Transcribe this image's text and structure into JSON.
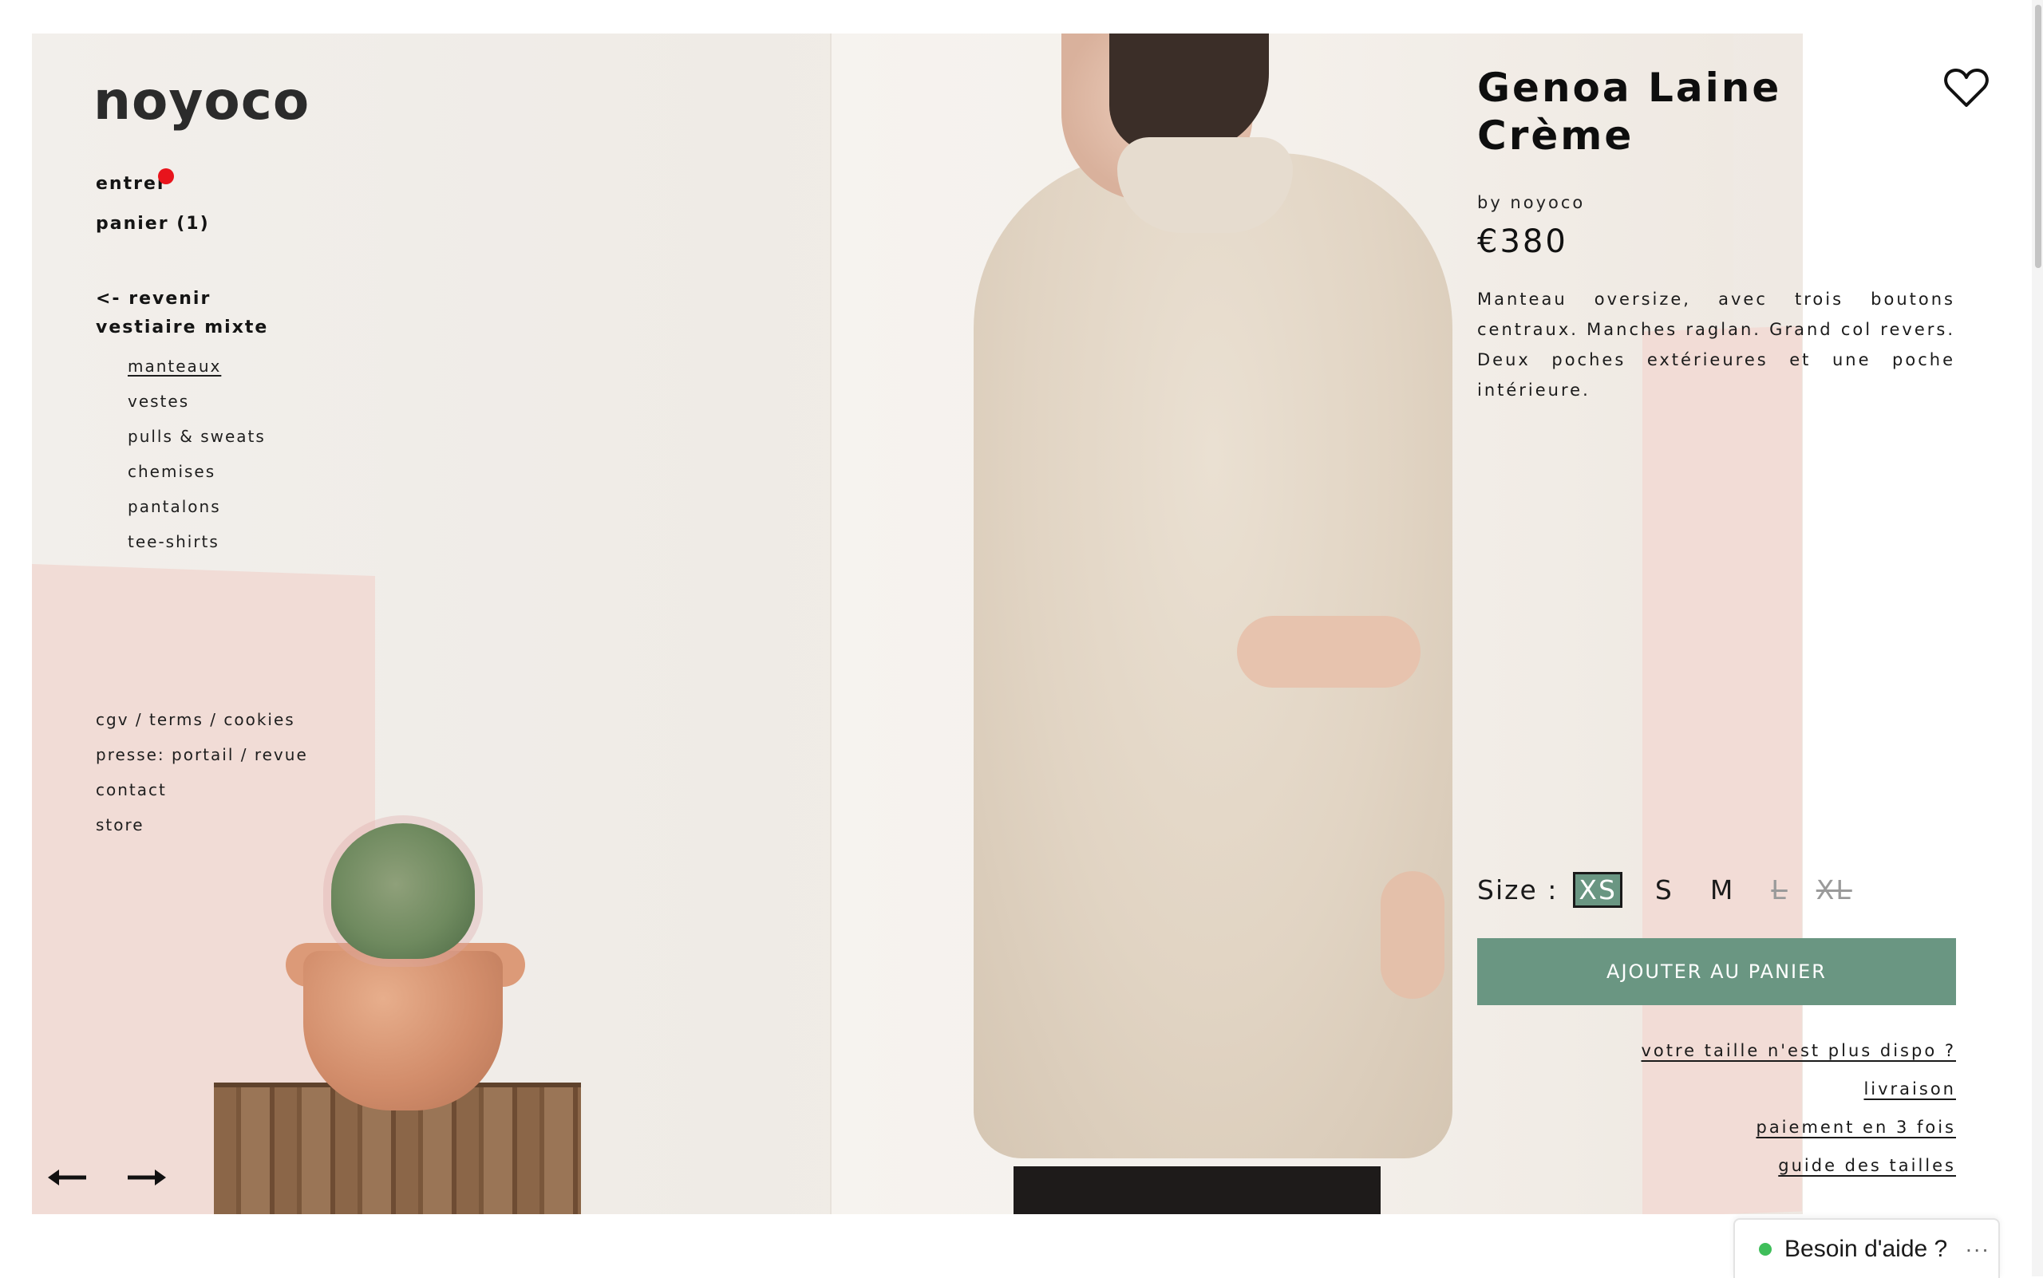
{
  "brand": {
    "logo": "noyoco"
  },
  "nav": {
    "login": "entrer",
    "cart": "panier (1)",
    "back": "<- revenir",
    "section": "vestiaire mixte",
    "categories": [
      "manteaux",
      "vestes",
      "pulls & sweats",
      "chemises",
      "pantalons",
      "tee-shirts"
    ],
    "active_category": "manteaux",
    "footer_links": [
      "cgv / terms / cookies",
      "presse: portail / revue",
      "contact",
      "store"
    ],
    "notification_dot_color": "#e8141c"
  },
  "gallery": {
    "prev_icon": "arrow-left-icon",
    "next_icon": "arrow-right-icon"
  },
  "product": {
    "title_line1": "Genoa Laine",
    "title_line2": "Crème",
    "byline": "by noyoco",
    "price": "€380",
    "description": "Manteau oversize, avec trois boutons centraux. Manches raglan. Grand col revers. Deux poches extérieures et une poche intérieure.",
    "size_label": "Size :",
    "sizes": [
      {
        "label": "XS",
        "state": "selected"
      },
      {
        "label": "S",
        "state": "available"
      },
      {
        "label": "M",
        "state": "available"
      },
      {
        "label": "L",
        "state": "unavailable"
      },
      {
        "label": "XL",
        "state": "unavailable"
      }
    ],
    "add_to_cart": "AJOUTER AU PANIER",
    "links": [
      "votre taille n'est plus dispo ?",
      "livraison",
      "paiement en 3 fois",
      "guide des tailles"
    ],
    "accent_color": "#6a9682",
    "favorite_icon": "heart-icon"
  },
  "help_widget": {
    "label": "Besoin d'aide ?",
    "more": "···",
    "status_color": "#3fbe5a"
  }
}
